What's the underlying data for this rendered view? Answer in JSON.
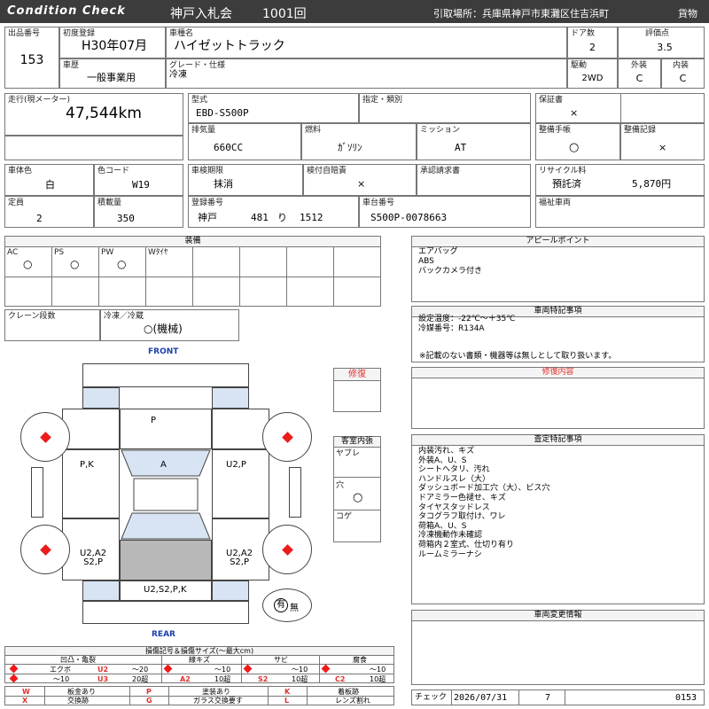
{
  "header": {
    "left_title": "Condition Check",
    "auction": "神戸入札会",
    "session": "1001回",
    "pickup": "引取場所：兵庫県神戸市東灘区住吉浜町",
    "category": "貨物"
  },
  "row1": {
    "lot_no_label": "出品番号",
    "lot_no": "153",
    "first_reg_label": "初度登録",
    "first_reg": "H30年07月",
    "car_name_label": "車種名",
    "car_name": "ハイゼットトラック",
    "doors_label": "ドア数",
    "doors": "2",
    "score_label": "評価点",
    "score": "3.5",
    "history_label": "車歴",
    "history": "一般事業用",
    "grade_label": "グレード・仕様",
    "grade": "冷凍",
    "drive_label": "駆動",
    "drive": "2WD",
    "exterior_label": "外装",
    "exterior": "C",
    "interior_label": "内装",
    "interior": "C"
  },
  "row2": {
    "mileage_label": "走行(現メーター)",
    "mileage": "47,544km",
    "model_label": "型式",
    "model": "EBD-S500P",
    "designation_label": "指定・類別",
    "warranty_label": "保証書",
    "warranty": "×",
    "displacement_label": "排気量",
    "displacement": "660CC",
    "fuel_label": "燃料",
    "fuel": "ｶﾞｿﾘﾝ",
    "transmission_label": "ミッション",
    "transmission": "AT",
    "manual_label": "整備手帳",
    "manual": "○",
    "record_label": "整備記録",
    "record": "×"
  },
  "row3": {
    "body_color_label": "車体色",
    "body_color": "白",
    "color_code_label": "色コード",
    "color_code": "W19",
    "inspection_label": "車検期限",
    "inspection": "抹消",
    "tax_label": "検付自賠責",
    "tax": "×",
    "approval_label": "承認請求書",
    "recycle_label": "リサイクル料",
    "recycle_status": "預託済",
    "recycle_amount": "5,870円",
    "capacity_label": "定員",
    "capacity": "2",
    "load_label": "積載量",
    "load": "350",
    "reg_no_label": "登録番号",
    "reg_area": "神戸",
    "reg_class": "481",
    "reg_kana": "り",
    "reg_num": "1512",
    "chassis_label": "車台番号",
    "chassis": "S500P-0078663",
    "welfare_label": "福祉車両"
  },
  "equipment": {
    "title": "装備",
    "items": [
      {
        "label": "AC",
        "mark": "○"
      },
      {
        "label": "PS",
        "mark": "○"
      },
      {
        "label": "PW",
        "mark": "○"
      },
      {
        "label": "Wﾀｲﾔ",
        "mark": ""
      }
    ],
    "crane_label": "クレーン段数",
    "freezer_label": "冷凍／冷蔵",
    "freezer": "○(機械)"
  },
  "appeal": {
    "title": "アピールポイント",
    "lines": "エアバッグ\nABS\nバックカメラ付き"
  },
  "vehicle_notes": {
    "title": "車両特記事項",
    "lines": "設定温度：-22℃～＋35℃\n冷媒番号：R134A",
    "footer": "※記載のない書類・機器等は無しとして取り扱います。"
  },
  "diagram": {
    "front": "FRONT",
    "rear": "REAR",
    "labels": {
      "top": "P",
      "left_mid": "P,K",
      "center": "A",
      "right_mid": "U2,P",
      "left_rear": "U2,A2\nS2,P",
      "right_rear": "U2,A2\nS2,P",
      "bottom": "U2,S2,P,K"
    },
    "spare": "有",
    "spare_none": "無"
  },
  "repair": {
    "title": "修復"
  },
  "cabin": {
    "title": "客室内張",
    "tear_label": "ヤブレ",
    "hole_label": "穴",
    "hole": "○",
    "burn_label": "コゲ"
  },
  "repair_detail": {
    "title": "修復内容"
  },
  "inspection_notes": {
    "title": "査定特記事項",
    "lines": "内装汚れ、キズ\n外装A、U、S\nシートヘタリ、汚れ\nハンドルスレ（大）\nダッシュボード加工穴（大）、ビス穴\nドアミラー色褪せ、キズ\nタイヤスタッドレス\nタコグラフ取付け、ワレ\n荷箱A、U、S\n冷凍機動作未確認\n荷箱内２室式、仕切り有り\nルームミラーナシ"
  },
  "change_info": {
    "title": "車両変更情報"
  },
  "legend": {
    "title": "損傷記号＆損傷サイズ(～最大cm)",
    "groups": [
      {
        "name": "凹凸・亀裂",
        "c1": "エクボ",
        "c2": "U2",
        "c3": "～20",
        "c4": "～10",
        "c5": "U3",
        "c6": "20超"
      },
      {
        "name": "線キズ",
        "c1": "A2",
        "c2": "～10",
        "c3": "10超"
      },
      {
        "name": "サビ",
        "c1": "S2",
        "c2": "～10",
        "c3": "10超"
      },
      {
        "name": "腐食",
        "c1": "C2",
        "c2": "～10",
        "c3": "10超"
      }
    ],
    "codes": [
      {
        "code": "W",
        "desc": "板金あり"
      },
      {
        "code": "P",
        "desc": "塗装あり"
      },
      {
        "code": "K",
        "desc": "着板跡"
      },
      {
        "code": "X",
        "desc": "交換跡"
      },
      {
        "code": "G",
        "desc": "ガラス交換要す"
      },
      {
        "code": "L",
        "desc": "レンズ割れ"
      }
    ]
  },
  "check": {
    "label": "チェック",
    "date": "2026/07/31",
    "num": "7",
    "id": "0153"
  },
  "colors": {
    "header_bg": "#3c3c3c",
    "accent_red": "#e0302a",
    "blue_front": "#1a3fb0",
    "panel_blue": "#d8e4f3"
  }
}
